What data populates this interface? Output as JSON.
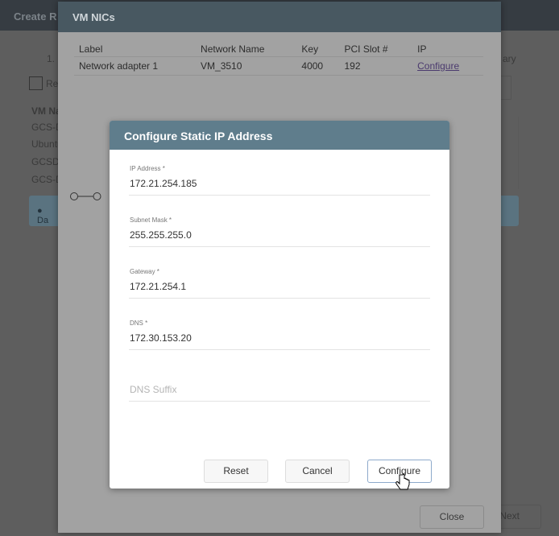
{
  "background": {
    "title": "Create R",
    "step": "1.",
    "checkbox_label": "Re",
    "col": "VM Na",
    "rows": [
      "GCS-D",
      "Ubuntu",
      "GCSD",
      "GCS-D"
    ],
    "info": "Da",
    "right_label": "ary",
    "next": "Next"
  },
  "nics": {
    "title": "VM NICs",
    "columns": [
      "Label",
      "Network Name",
      "Key",
      "PCI Slot #",
      "IP"
    ],
    "rows": [
      {
        "label": "Network adapter 1",
        "network": "VM_3510",
        "key": "4000",
        "pci": "192",
        "ip": "Configure"
      }
    ],
    "close": "Close"
  },
  "dialog": {
    "title": "Configure Static IP Address",
    "fields": [
      {
        "label": "IP Address *",
        "value": "172.21.254.185"
      },
      {
        "label": "Subnet Mask *",
        "value": "255.255.255.0"
      },
      {
        "label": "Gateway *",
        "value": "172.21.254.1"
      },
      {
        "label": "DNS *",
        "value": "172.30.153.20"
      },
      {
        "placeholder": "DNS Suffix"
      }
    ],
    "reset": "Reset",
    "cancel": "Cancel",
    "configure": "Configure"
  }
}
